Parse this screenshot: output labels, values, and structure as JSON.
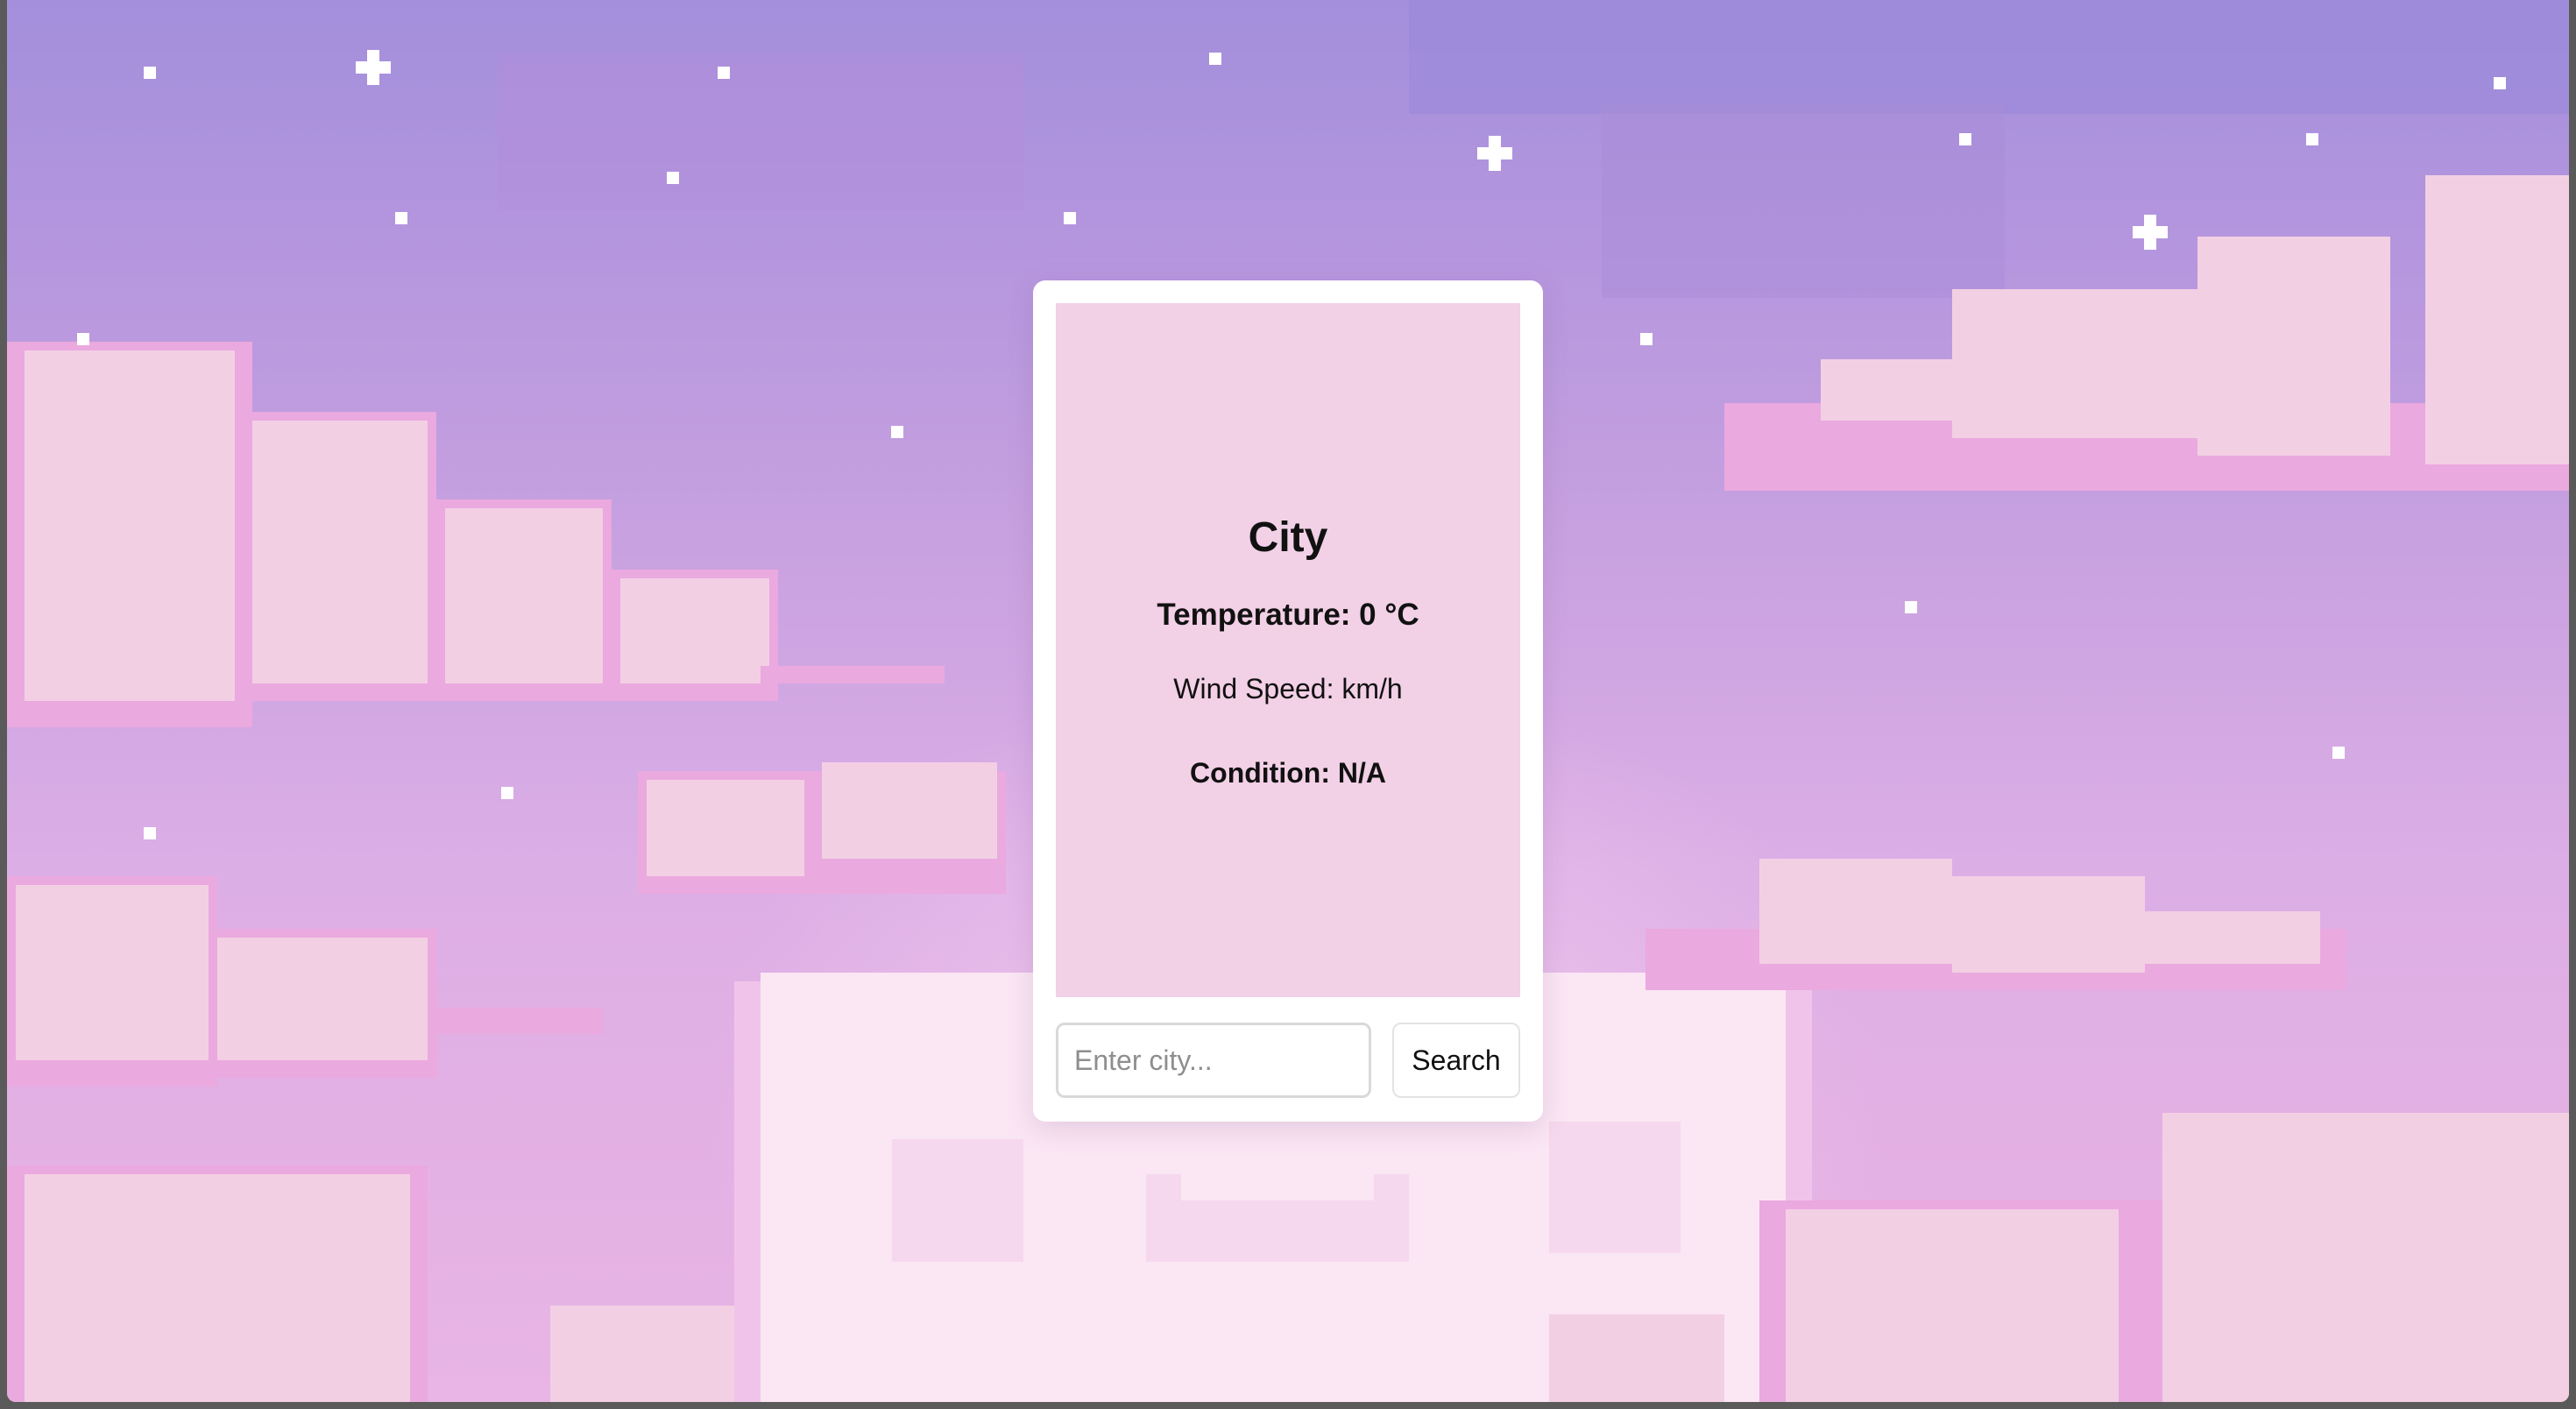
{
  "weather": {
    "city": "City",
    "temperature": "Temperature: 0 °C",
    "wind_speed": "Wind Speed: km/h",
    "condition": "Condition: N/A"
  },
  "search": {
    "placeholder": "Enter city...",
    "button_label": "Search"
  },
  "background": {
    "theme": "pixel-art pastel sky with clouds and stars",
    "colors": {
      "sky_top": "#a38fdc",
      "sky_bottom": "#e8b5e6",
      "cloud_light": "#f3cfe4",
      "cloud_shadow": "#eaa9df",
      "star": "#ffffff",
      "card_panel": "#f2d0e6"
    }
  }
}
